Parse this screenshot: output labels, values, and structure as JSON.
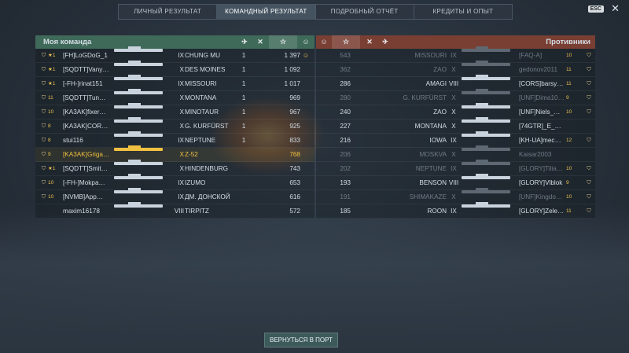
{
  "tabs": [
    "ЛИЧНЫЙ РЕЗУЛЬТАТ",
    "КОМАНДНЫЙ РЕЗУЛЬТАТ",
    "ПОДРОБНЫЙ ОТЧЁТ",
    "КРЕДИТЫ И ОПЫТ"
  ],
  "active_tab": 1,
  "esc_label": "ESC",
  "close_glyph": "✕",
  "my_team": {
    "title": "Моя команда",
    "icons": [
      "aircraft-icon",
      "planes-shot-icon",
      "star-icon",
      "achievement-icon"
    ],
    "rows": [
      {
        "rank": "★1",
        "name": "[FH]LoGDoG_1",
        "tier": "IX",
        "ship": "CHUNG MU",
        "kills": "1",
        "xp": "1 397",
        "icon": "☺",
        "dead": false,
        "me": false
      },
      {
        "rank": "★1",
        "name": "[SQDTT]Vany…",
        "tier": "X",
        "ship": "DES MOINES",
        "kills": "1",
        "xp": "1 092",
        "icon": "",
        "dead": false,
        "me": false
      },
      {
        "rank": "★1",
        "name": "[-FH-]rinat151",
        "tier": "IX",
        "ship": "MISSOURI",
        "kills": "1",
        "xp": "1 017",
        "icon": "",
        "dead": false,
        "me": false
      },
      {
        "rank": "11",
        "name": "[SQDTT]Tun…",
        "tier": "X",
        "ship": "MONTANA",
        "kills": "1",
        "xp": "969",
        "icon": "",
        "dead": false,
        "me": false
      },
      {
        "rank": "10",
        "name": "[KA3AK]fixer…",
        "tier": "X",
        "ship": "MINOTAUR",
        "kills": "1",
        "xp": "967",
        "icon": "",
        "dead": false,
        "me": false
      },
      {
        "rank": "8",
        "name": "[KA3AK]COR…",
        "tier": "X",
        "ship": "G. KURFÜRST",
        "kills": "1",
        "xp": "925",
        "icon": "",
        "dead": false,
        "me": false
      },
      {
        "rank": "8",
        "name": "stui116",
        "tier": "IX",
        "ship": "NEPTUNE",
        "kills": "1",
        "xp": "833",
        "icon": "",
        "dead": false,
        "me": false
      },
      {
        "rank": "9",
        "name": "[KA3AK]Griga…",
        "tier": "X",
        "ship": "Z-52",
        "kills": "",
        "xp": "768",
        "icon": "",
        "dead": false,
        "me": true
      },
      {
        "rank": "★1",
        "name": "[SQDTT]Smit…",
        "tier": "X",
        "ship": "HINDENBURG",
        "kills": "",
        "xp": "743",
        "icon": "",
        "dead": false,
        "me": false
      },
      {
        "rank": "10",
        "name": "[-FH-]Mokpa…",
        "tier": "IX",
        "ship": "IZUMO",
        "kills": "",
        "xp": "653",
        "icon": "",
        "dead": false,
        "me": false
      },
      {
        "rank": "10",
        "name": "[NVMB]App…",
        "tier": "IX",
        "ship": "ДМ. ДОНСКОЙ",
        "kills": "",
        "xp": "616",
        "icon": "",
        "dead": false,
        "me": false
      },
      {
        "rank": "",
        "name": "maxim16178",
        "tier": "VIII",
        "ship": "TIRPITZ",
        "kills": "",
        "xp": "572",
        "icon": "",
        "dead": false,
        "me": false
      }
    ]
  },
  "enemies": {
    "title": "Противники",
    "icons": [
      "achievement-icon",
      "star-icon",
      "planes-shot-icon",
      "aircraft-icon"
    ],
    "rows": [
      {
        "xp": "543",
        "ship": "MISSOURI",
        "tier": "IX",
        "name": "[FAQ-A]",
        "rank": "10",
        "dead": true
      },
      {
        "xp": "362",
        "ship": "ZAO",
        "tier": "X",
        "name": "gedonov2011",
        "rank": "11",
        "dead": true
      },
      {
        "xp": "286",
        "ship": "AMAGI",
        "tier": "VIII",
        "name": "[CORS]barsy…",
        "rank": "11",
        "dead": false
      },
      {
        "xp": "280",
        "ship": "G. KURFÜRST",
        "tier": "X",
        "name": "[UNF]Dima10…",
        "rank": "9",
        "dead": true
      },
      {
        "xp": "240",
        "ship": "ZAO",
        "tier": "X",
        "name": "[UNF]Niels_…",
        "rank": "10",
        "dead": false
      },
      {
        "xp": "227",
        "ship": "MONTANA",
        "tier": "X",
        "name": "[74GTR]_E_…",
        "rank": "",
        "dead": false
      },
      {
        "xp": "216",
        "ship": "IOWA",
        "tier": "IX",
        "name": "[KH-UA]mec…",
        "rank": "12",
        "dead": false
      },
      {
        "xp": "206",
        "ship": "MOSKVA",
        "tier": "X",
        "name": "Kaisar2003",
        "rank": "",
        "dead": true
      },
      {
        "xp": "202",
        "ship": "NEPTUNE",
        "tier": "IX",
        "name": "[GLORY]Tilia…",
        "rank": "10",
        "dead": true
      },
      {
        "xp": "193",
        "ship": "BENSON",
        "tier": "VIII",
        "name": "[GLORY]Vlblok",
        "rank": "9",
        "dead": false
      },
      {
        "xp": "191",
        "ship": "SHIMAKAZE",
        "tier": "X",
        "name": "[UNF]Kingdo…",
        "rank": "10",
        "dead": true
      },
      {
        "xp": "185",
        "ship": "ROON",
        "tier": "IX",
        "name": "[GLORY]Zele…",
        "rank": "11",
        "dead": false
      }
    ]
  },
  "return_button": "ВЕРНУТЬСЯ В ПОРТ"
}
